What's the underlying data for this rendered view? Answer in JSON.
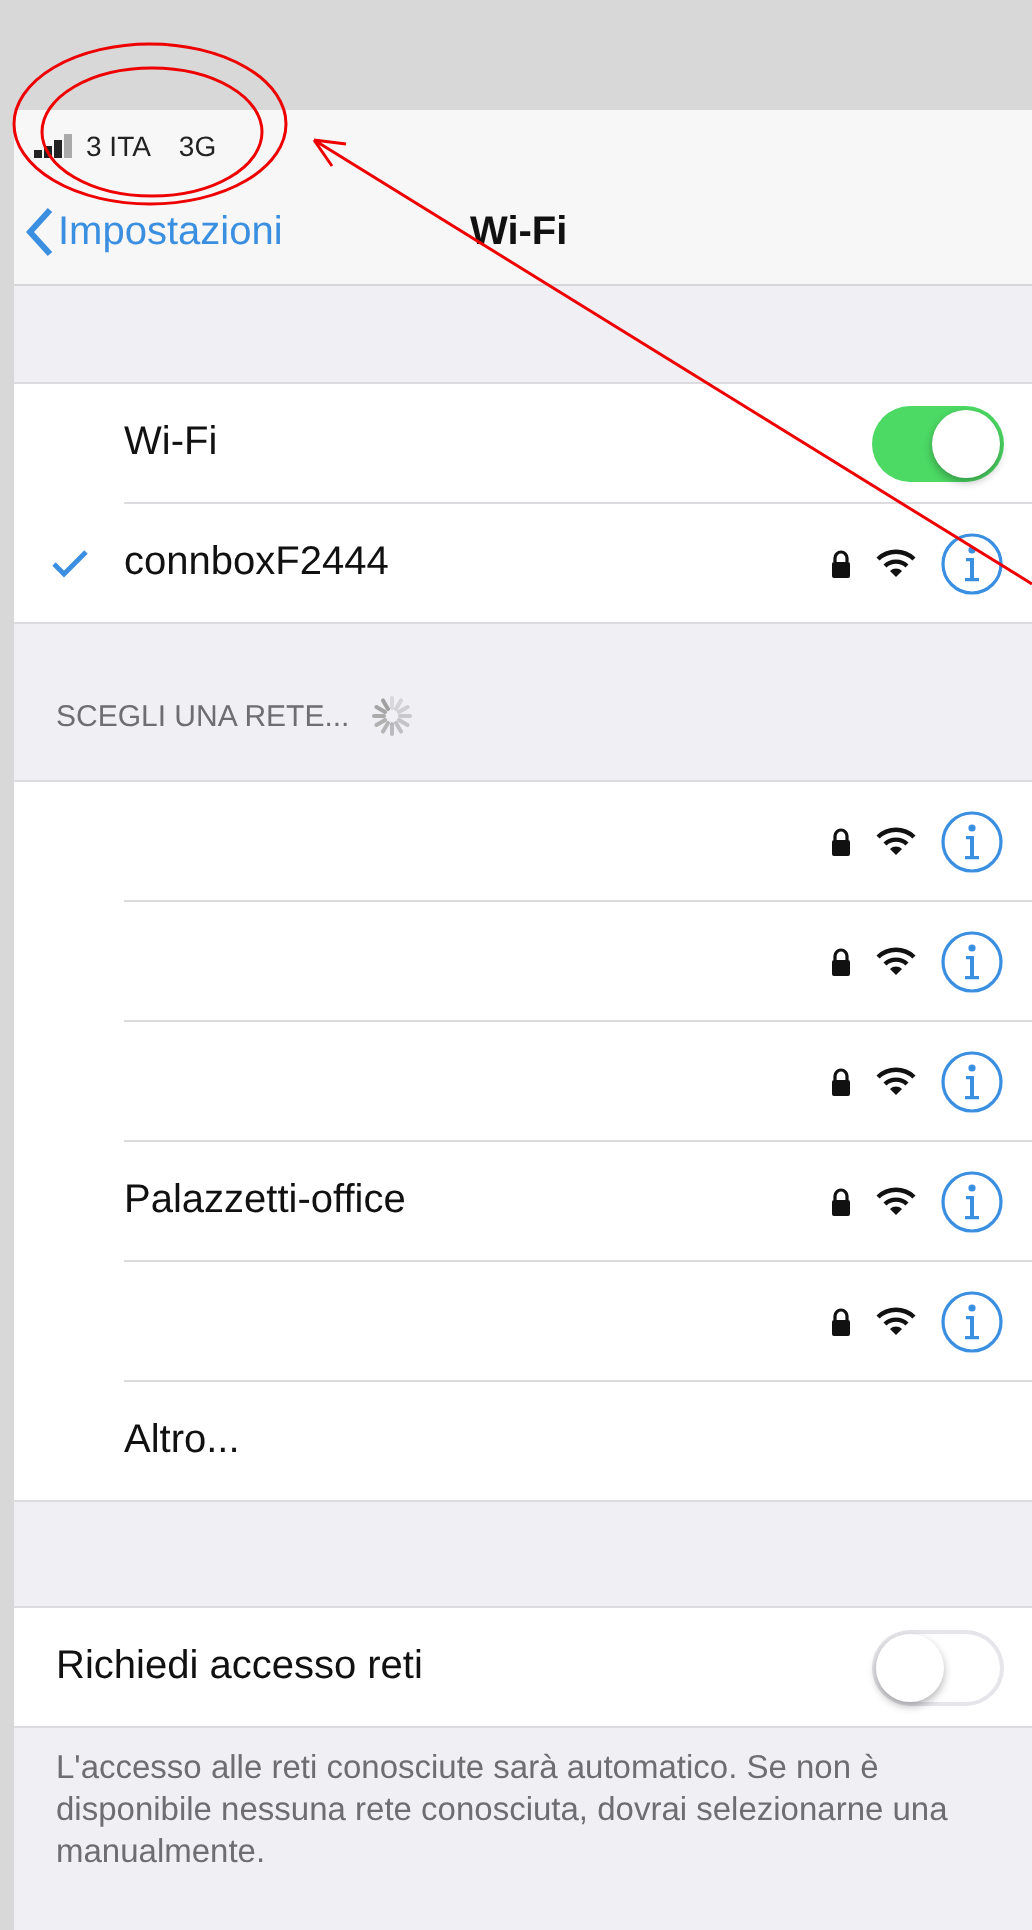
{
  "status_bar": {
    "carrier": "3 ITA",
    "network_type": "3G"
  },
  "nav_bar": {
    "back_label": "Impostazioni",
    "title": "Wi-Fi"
  },
  "wifi": {
    "label": "Wi-Fi",
    "on": true
  },
  "current_network": {
    "name": "connboxF2444",
    "checked": true,
    "locked": true
  },
  "networks_section": {
    "header": "SCEGLI UNA RETE...",
    "loading": true
  },
  "networks": [
    {
      "locked": true
    },
    {
      "locked": true
    },
    {
      "locked": true
    },
    {
      "name": "Palazzetti-office",
      "locked": true
    },
    {
      "locked": true
    }
  ],
  "other_item": "Altro...",
  "ask_to_join": {
    "label": "Richiedi accesso reti",
    "on": false
  },
  "footer": "L'accesso alle reti conosciute sarà automatico. Se non è disponibile nessuna rete conosciuta, dovrai selezionarne una manualmente."
}
